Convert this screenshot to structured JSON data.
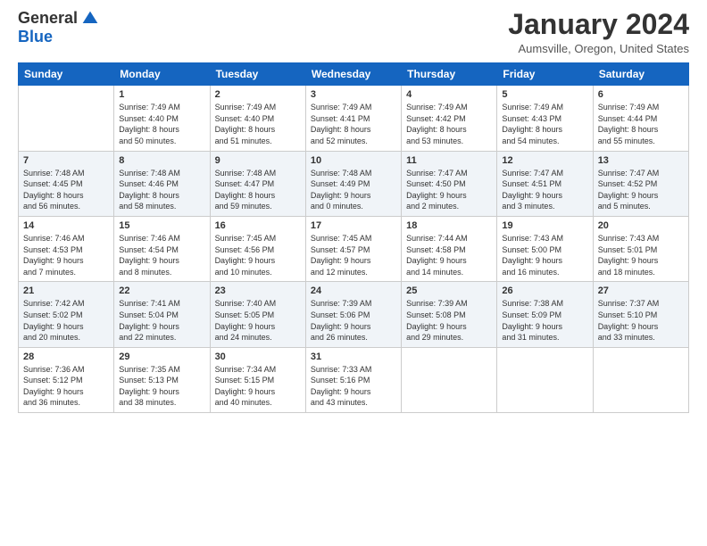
{
  "logo": {
    "general": "General",
    "blue": "Blue"
  },
  "title": "January 2024",
  "subtitle": "Aumsville, Oregon, United States",
  "days_of_week": [
    "Sunday",
    "Monday",
    "Tuesday",
    "Wednesday",
    "Thursday",
    "Friday",
    "Saturday"
  ],
  "weeks": [
    [
      {
        "day": "",
        "info": ""
      },
      {
        "day": "1",
        "info": "Sunrise: 7:49 AM\nSunset: 4:40 PM\nDaylight: 8 hours\nand 50 minutes."
      },
      {
        "day": "2",
        "info": "Sunrise: 7:49 AM\nSunset: 4:40 PM\nDaylight: 8 hours\nand 51 minutes."
      },
      {
        "day": "3",
        "info": "Sunrise: 7:49 AM\nSunset: 4:41 PM\nDaylight: 8 hours\nand 52 minutes."
      },
      {
        "day": "4",
        "info": "Sunrise: 7:49 AM\nSunset: 4:42 PM\nDaylight: 8 hours\nand 53 minutes."
      },
      {
        "day": "5",
        "info": "Sunrise: 7:49 AM\nSunset: 4:43 PM\nDaylight: 8 hours\nand 54 minutes."
      },
      {
        "day": "6",
        "info": "Sunrise: 7:49 AM\nSunset: 4:44 PM\nDaylight: 8 hours\nand 55 minutes."
      }
    ],
    [
      {
        "day": "7",
        "info": "Sunrise: 7:48 AM\nSunset: 4:45 PM\nDaylight: 8 hours\nand 56 minutes."
      },
      {
        "day": "8",
        "info": "Sunrise: 7:48 AM\nSunset: 4:46 PM\nDaylight: 8 hours\nand 58 minutes."
      },
      {
        "day": "9",
        "info": "Sunrise: 7:48 AM\nSunset: 4:47 PM\nDaylight: 8 hours\nand 59 minutes."
      },
      {
        "day": "10",
        "info": "Sunrise: 7:48 AM\nSunset: 4:49 PM\nDaylight: 9 hours\nand 0 minutes."
      },
      {
        "day": "11",
        "info": "Sunrise: 7:47 AM\nSunset: 4:50 PM\nDaylight: 9 hours\nand 2 minutes."
      },
      {
        "day": "12",
        "info": "Sunrise: 7:47 AM\nSunset: 4:51 PM\nDaylight: 9 hours\nand 3 minutes."
      },
      {
        "day": "13",
        "info": "Sunrise: 7:47 AM\nSunset: 4:52 PM\nDaylight: 9 hours\nand 5 minutes."
      }
    ],
    [
      {
        "day": "14",
        "info": "Sunrise: 7:46 AM\nSunset: 4:53 PM\nDaylight: 9 hours\nand 7 minutes."
      },
      {
        "day": "15",
        "info": "Sunrise: 7:46 AM\nSunset: 4:54 PM\nDaylight: 9 hours\nand 8 minutes."
      },
      {
        "day": "16",
        "info": "Sunrise: 7:45 AM\nSunset: 4:56 PM\nDaylight: 9 hours\nand 10 minutes."
      },
      {
        "day": "17",
        "info": "Sunrise: 7:45 AM\nSunset: 4:57 PM\nDaylight: 9 hours\nand 12 minutes."
      },
      {
        "day": "18",
        "info": "Sunrise: 7:44 AM\nSunset: 4:58 PM\nDaylight: 9 hours\nand 14 minutes."
      },
      {
        "day": "19",
        "info": "Sunrise: 7:43 AM\nSunset: 5:00 PM\nDaylight: 9 hours\nand 16 minutes."
      },
      {
        "day": "20",
        "info": "Sunrise: 7:43 AM\nSunset: 5:01 PM\nDaylight: 9 hours\nand 18 minutes."
      }
    ],
    [
      {
        "day": "21",
        "info": "Sunrise: 7:42 AM\nSunset: 5:02 PM\nDaylight: 9 hours\nand 20 minutes."
      },
      {
        "day": "22",
        "info": "Sunrise: 7:41 AM\nSunset: 5:04 PM\nDaylight: 9 hours\nand 22 minutes."
      },
      {
        "day": "23",
        "info": "Sunrise: 7:40 AM\nSunset: 5:05 PM\nDaylight: 9 hours\nand 24 minutes."
      },
      {
        "day": "24",
        "info": "Sunrise: 7:39 AM\nSunset: 5:06 PM\nDaylight: 9 hours\nand 26 minutes."
      },
      {
        "day": "25",
        "info": "Sunrise: 7:39 AM\nSunset: 5:08 PM\nDaylight: 9 hours\nand 29 minutes."
      },
      {
        "day": "26",
        "info": "Sunrise: 7:38 AM\nSunset: 5:09 PM\nDaylight: 9 hours\nand 31 minutes."
      },
      {
        "day": "27",
        "info": "Sunrise: 7:37 AM\nSunset: 5:10 PM\nDaylight: 9 hours\nand 33 minutes."
      }
    ],
    [
      {
        "day": "28",
        "info": "Sunrise: 7:36 AM\nSunset: 5:12 PM\nDaylight: 9 hours\nand 36 minutes."
      },
      {
        "day": "29",
        "info": "Sunrise: 7:35 AM\nSunset: 5:13 PM\nDaylight: 9 hours\nand 38 minutes."
      },
      {
        "day": "30",
        "info": "Sunrise: 7:34 AM\nSunset: 5:15 PM\nDaylight: 9 hours\nand 40 minutes."
      },
      {
        "day": "31",
        "info": "Sunrise: 7:33 AM\nSunset: 5:16 PM\nDaylight: 9 hours\nand 43 minutes."
      },
      {
        "day": "",
        "info": ""
      },
      {
        "day": "",
        "info": ""
      },
      {
        "day": "",
        "info": ""
      }
    ]
  ]
}
